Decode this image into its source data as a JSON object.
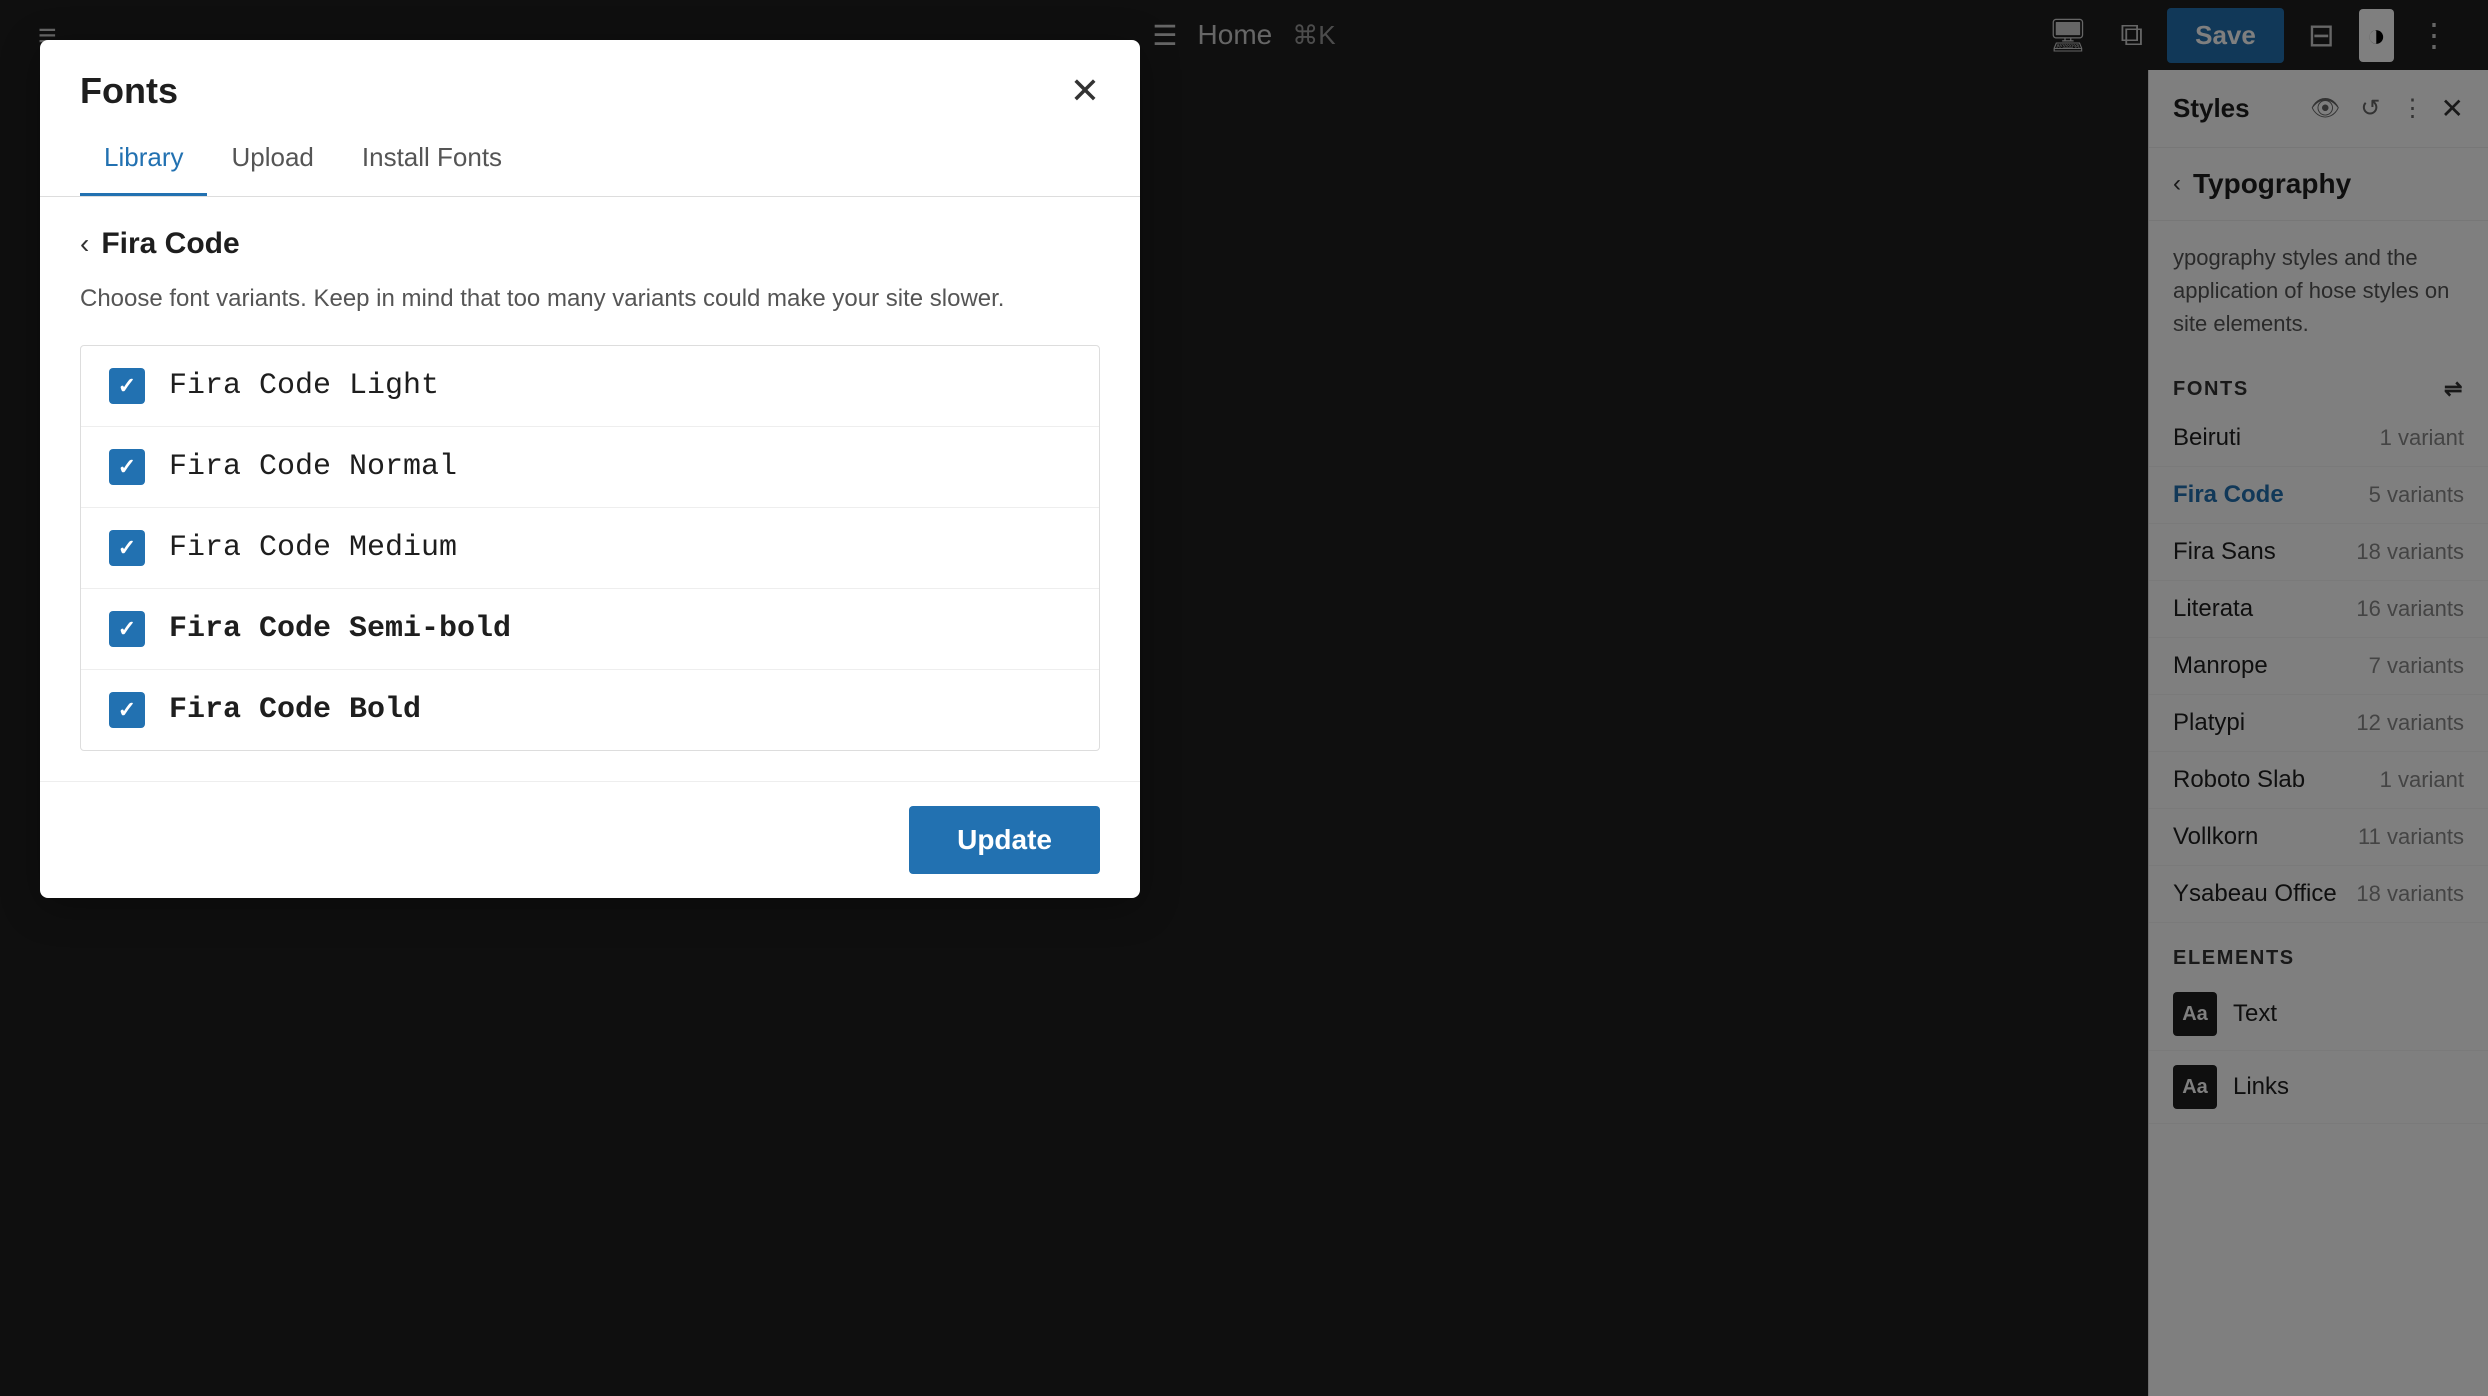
{
  "toolbar": {
    "hamburger_label": "≡",
    "page_icon": "☰",
    "page_title": "Home",
    "keyboard_shortcut": "⌘K",
    "save_label": "Save",
    "preview_icon": "🖥",
    "external_icon": "⧉",
    "layout_icon": "⊟",
    "contrast_icon": "◑",
    "more_icon": "⋮"
  },
  "right_sidebar": {
    "title": "Styles",
    "eye_icon": "👁",
    "history_icon": "↺",
    "more_icon": "⋮",
    "close_icon": "✕",
    "back_icon": "‹",
    "typography_title": "Typography",
    "typography_desc": "ypography styles and the application of\nhose styles on site elements.",
    "fonts_section_label": "FONTS",
    "adjust_icon": "⇌",
    "fonts": [
      {
        "name": "Beiruti",
        "variants": "1 variant",
        "active": false
      },
      {
        "name": "Fira Code",
        "variants": "5 variants",
        "active": true
      },
      {
        "name": "Fira Sans",
        "variants": "18 variants",
        "active": false
      },
      {
        "name": "Literata",
        "variants": "16 variants",
        "active": false
      },
      {
        "name": "Manrope",
        "variants": "7 variants",
        "active": false
      },
      {
        "name": "Platypi",
        "variants": "12 variants",
        "active": false
      },
      {
        "name": "Roboto Slab",
        "variants": "1 variant",
        "active": false
      },
      {
        "name": "Vollkorn",
        "variants": "11 variants",
        "active": false
      },
      {
        "name": "Ysabeau Office",
        "variants": "18 variants",
        "active": false
      }
    ],
    "elements_section_label": "ELEMENTS",
    "elements": [
      {
        "label": "Text",
        "icon": "Aa"
      },
      {
        "label": "Links",
        "icon": "Aa"
      }
    ]
  },
  "modal": {
    "title": "Fonts",
    "close_icon": "✕",
    "tabs": [
      {
        "label": "Library",
        "active": true
      },
      {
        "label": "Upload",
        "active": false
      },
      {
        "label": "Install Fonts",
        "active": false
      }
    ],
    "back_icon": "‹",
    "font_name": "Fira Code",
    "description": "Choose font variants. Keep in mind that too many variants could make your site slower.",
    "variants": [
      {
        "label": "Fira Code Light",
        "weight_class": "variant-light",
        "checked": true
      },
      {
        "label": "Fira Code Normal",
        "weight_class": "variant-normal",
        "checked": true
      },
      {
        "label": "Fira Code Medium",
        "weight_class": "variant-medium",
        "checked": true
      },
      {
        "label": "Fira Code Semi-bold",
        "weight_class": "variant-semibold",
        "checked": true
      },
      {
        "label": "Fira Code Bold",
        "weight_class": "variant-bold",
        "checked": true
      }
    ],
    "update_label": "Update"
  }
}
